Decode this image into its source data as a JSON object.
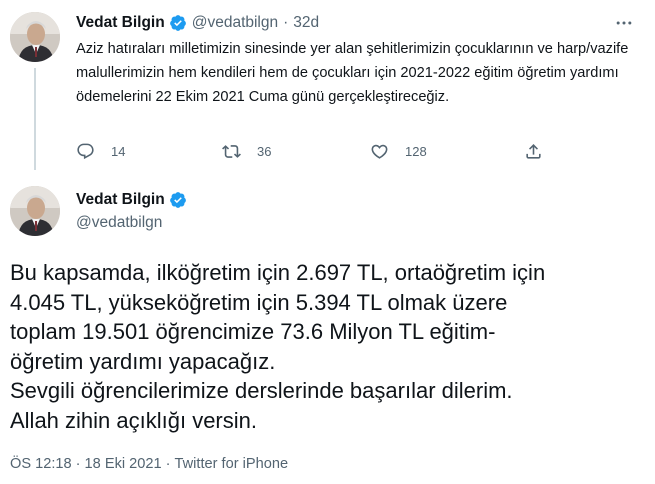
{
  "tweet1": {
    "author_name": "Vedat Bilgin",
    "handle": "@vedatbilgn",
    "separator": "·",
    "time_ago": "32d",
    "text": "Aziz hatıraları milletimizin sinesinde yer alan şehitlerimizin çocuklarının ve harp/vazife malullerimizin hem kendileri hem de çocukları için 2021-2022 eğitim öğretim yardımı ödemelerini 22 Ekim 2021 Cuma günü gerçekleştireceğiz.",
    "actions": {
      "reply_icon": "reply-icon",
      "reply_count": "14",
      "retweet_icon": "retweet-icon",
      "retweet_count": "36",
      "like_icon": "heart-icon",
      "like_count": "128",
      "share_icon": "share-icon"
    }
  },
  "tweet2": {
    "author_name": "Vedat Bilgin",
    "handle": "@vedatbilgn",
    "text_lines": [
      "Bu kapsamda, ilköğretim için 2.697 TL, ortaöğretim için",
      "4.045 TL, yükseköğretim için 5.394 TL olmak üzere",
      "toplam 19.501 öğrencimize 73.6 Milyon TL eğitim-",
      "öğretim yardımı yapacağız.",
      "Sevgili öğrencilerimize derslerinde başarılar dilerim.",
      "Allah zihin açıklığı versin."
    ],
    "meta": {
      "time": "ÖS 12:18",
      "separator": "·",
      "date": "18 Eki 2021",
      "source": "Twitter for iPhone"
    }
  },
  "colors": {
    "text_primary": "#0f1419",
    "text_secondary": "#536471",
    "verified_blue": "#1d9bf0",
    "thread_line": "#cfd9de"
  }
}
